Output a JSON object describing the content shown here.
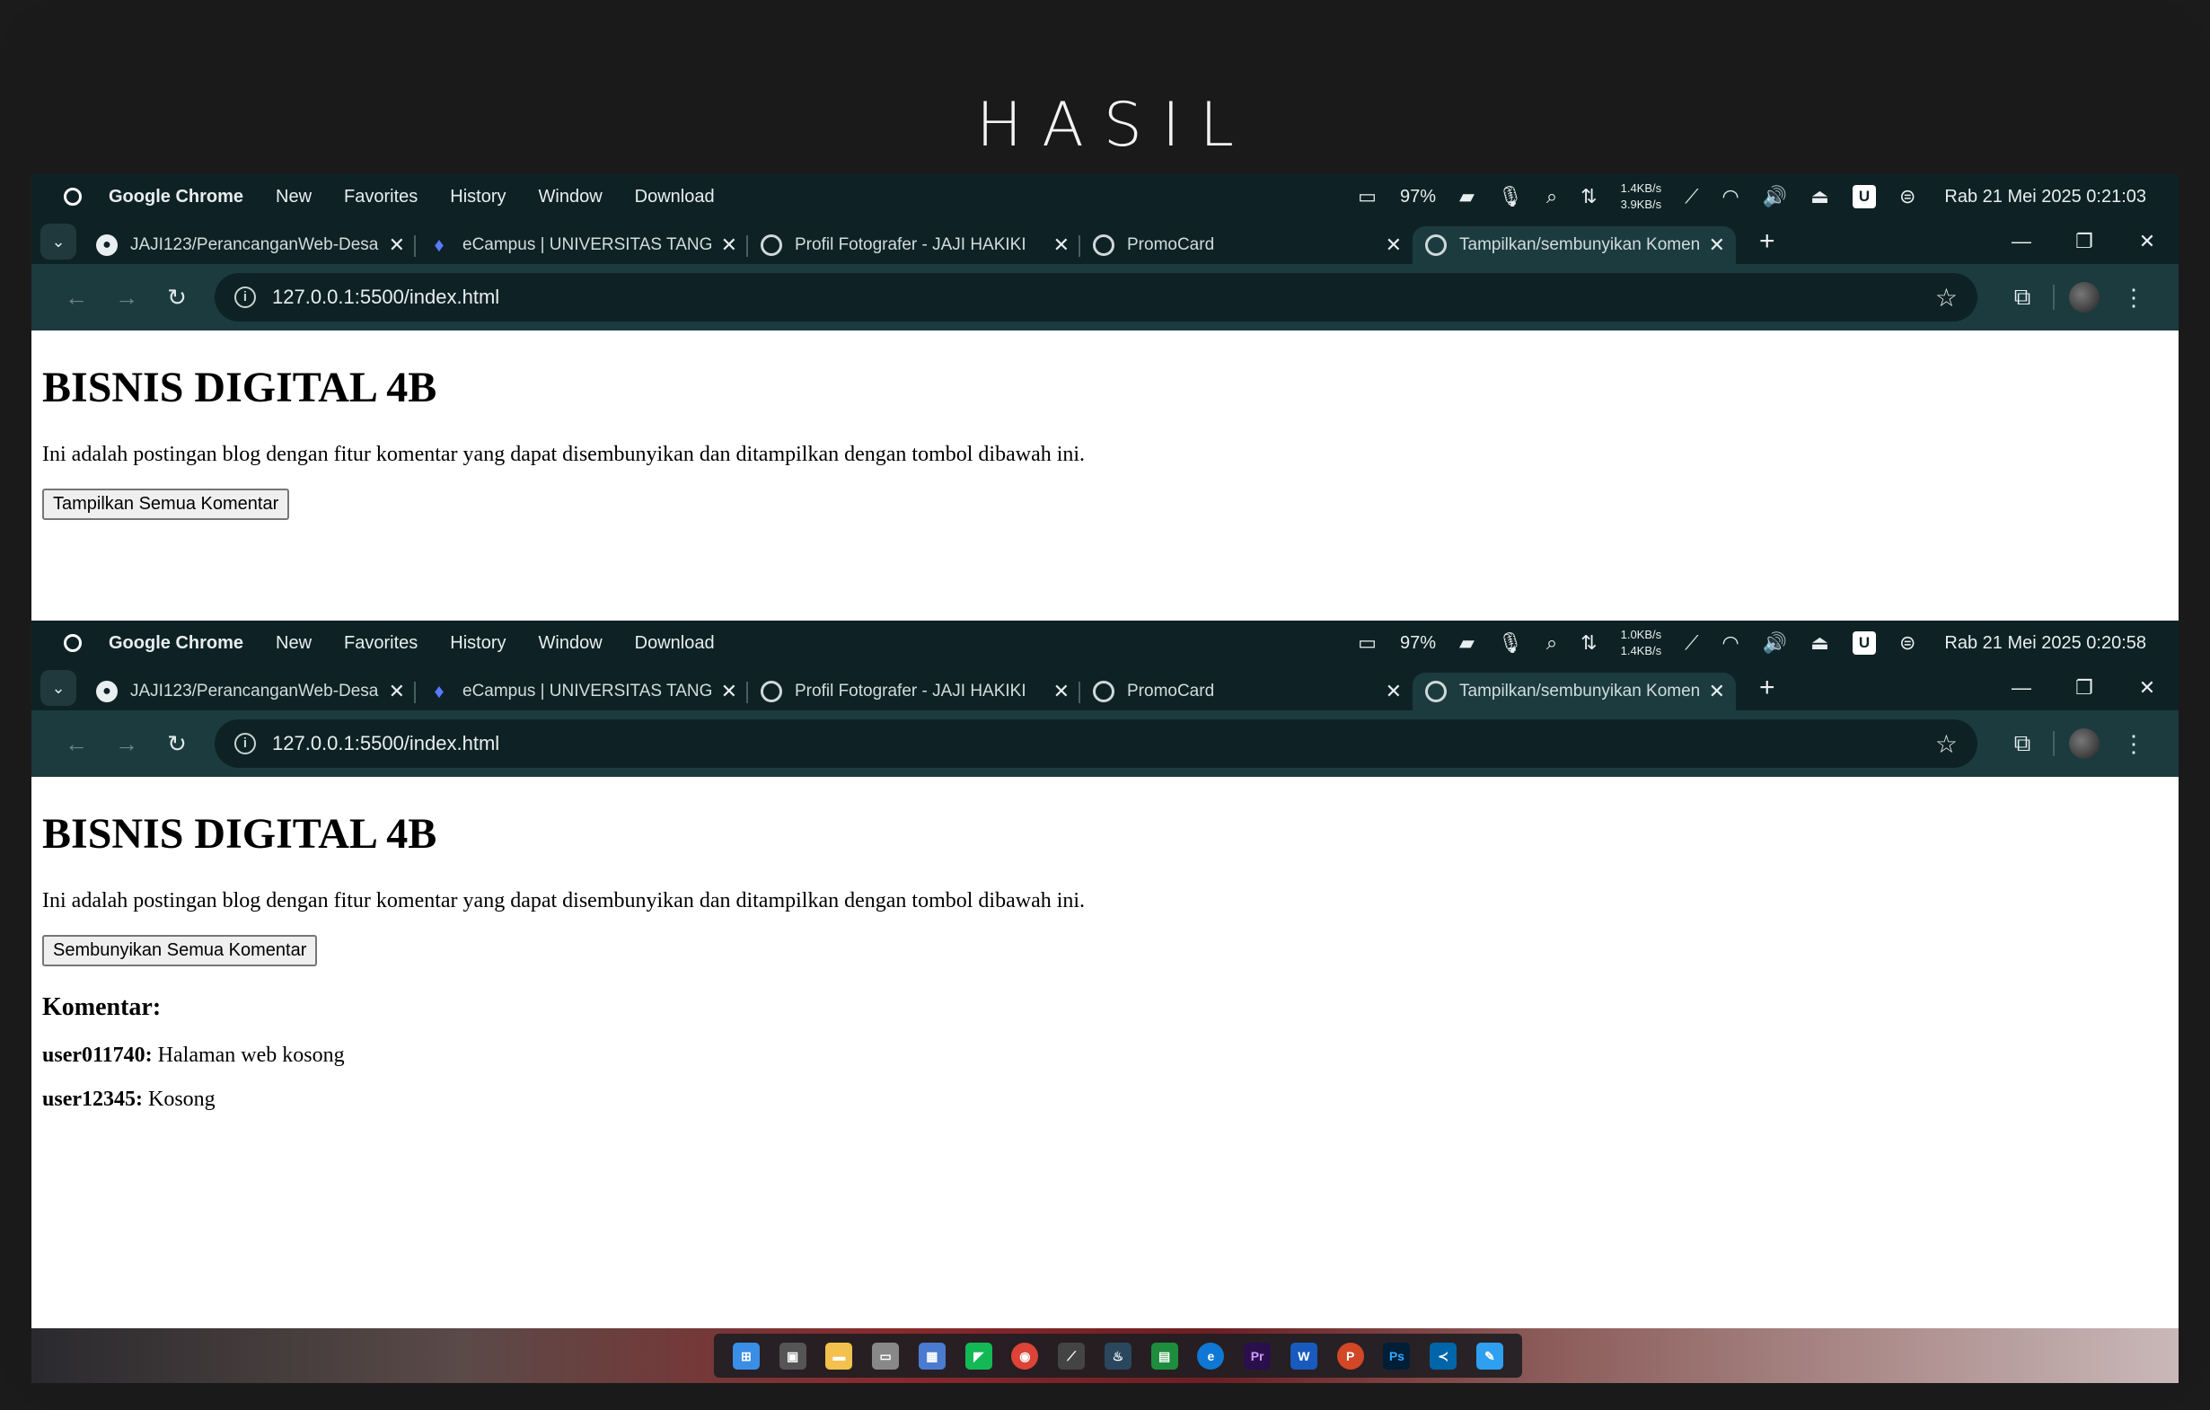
{
  "slide": {
    "title": "HASIL"
  },
  "windows": [
    {
      "menubar": {
        "app": "Google Chrome",
        "items": [
          "New",
          "Favorites",
          "History",
          "Window",
          "Download"
        ],
        "battery": "97%",
        "net_up": "1.4KB/s",
        "net_down": "3.9KB/s",
        "u_badge": "U",
        "clock": "Rab 21 Mei 2025 0:21:03"
      },
      "tabs": [
        {
          "title": "JAJI123/PerancanganWeb-Desa",
          "icon": "github-icon"
        },
        {
          "title": "eCampus | UNIVERSITAS TANGE",
          "icon": "flame-icon"
        },
        {
          "title": "Profil Fotografer - JAJI HAKIKI",
          "icon": "globe-icon"
        },
        {
          "title": "PromoCard",
          "icon": "globe-icon"
        },
        {
          "title": "Tampilkan/sembunyikan Komen",
          "icon": "globe-icon"
        }
      ],
      "url": "127.0.0.1:5500/index.html",
      "page": {
        "heading": "BISNIS DIGITAL 4B",
        "description": "Ini adalah postingan blog dengan fitur komentar yang dapat disembunyikan dan ditampilkan dengan tombol dibawah ini.",
        "button": "Tampilkan Semua Komentar"
      }
    },
    {
      "menubar": {
        "app": "Google Chrome",
        "items": [
          "New",
          "Favorites",
          "History",
          "Window",
          "Download"
        ],
        "battery": "97%",
        "net_up": "1.0KB/s",
        "net_down": "1.4KB/s",
        "u_badge": "U",
        "clock": "Rab 21 Mei 2025 0:20:58"
      },
      "tabs": [
        {
          "title": "JAJI123/PerancanganWeb-Desa",
          "icon": "github-icon"
        },
        {
          "title": "eCampus | UNIVERSITAS TANGE",
          "icon": "flame-icon"
        },
        {
          "title": "Profil Fotografer - JAJI HAKIKI",
          "icon": "globe-icon"
        },
        {
          "title": "PromoCard",
          "icon": "globe-icon"
        },
        {
          "title": "Tampilkan/sembunyikan Komen",
          "icon": "globe-icon"
        }
      ],
      "url": "127.0.0.1:5500/index.html",
      "page": {
        "heading": "BISNIS DIGITAL 4B",
        "description": "Ini adalah postingan blog dengan fitur komentar yang dapat disembunyikan dan ditampilkan dengan tombol dibawah ini.",
        "button": "Sembunyikan Semua Komentar",
        "comments_heading": "Komentar:",
        "comments": [
          {
            "user": "user011740:",
            "text": "Halaman web kosong"
          },
          {
            "user": "user12345:",
            "text": "Kosong"
          }
        ]
      }
    }
  ],
  "taskbar": {
    "apps": [
      "start-icon",
      "task-view-icon",
      "file-explorer-icon",
      "drive-icon",
      "store-icon",
      "line-icon",
      "chrome-icon",
      "app-icon",
      "steam-icon",
      "sheets-icon",
      "edge-icon",
      "premiere-icon",
      "word-icon",
      "powerpoint-icon",
      "photoshop-icon",
      "vscode-icon",
      "paint-icon"
    ],
    "labels": {
      "premiere": "Pr",
      "word": "W",
      "powerpoint": "P",
      "photoshop": "Ps"
    }
  }
}
